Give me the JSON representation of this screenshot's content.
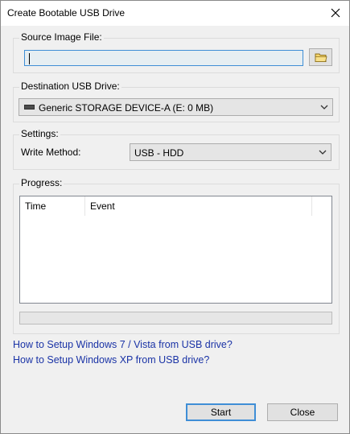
{
  "window": {
    "title": "Create Bootable USB Drive",
    "close_icon": "close-icon"
  },
  "source": {
    "label": "Source Image File:",
    "value": "",
    "browse_icon": "folder-icon"
  },
  "destination": {
    "label": "Destination USB Drive:",
    "selected": "Generic STORAGE DEVICE-A (E: 0 MB)",
    "icon": "drive-icon"
  },
  "settings": {
    "label": "Settings:",
    "write_method_label": "Write Method:",
    "write_method_value": "USB - HDD"
  },
  "progress": {
    "label": "Progress:",
    "columns": [
      "Time",
      "Event"
    ],
    "rows": [],
    "percent": 0
  },
  "links": [
    "How to Setup Windows 7 / Vista from USB drive?",
    "How to Setup Windows XP from USB drive?"
  ],
  "buttons": {
    "start": "Start",
    "close": "Close"
  },
  "colors": {
    "accent": "#3f8ed6",
    "link": "#1a33a6"
  }
}
